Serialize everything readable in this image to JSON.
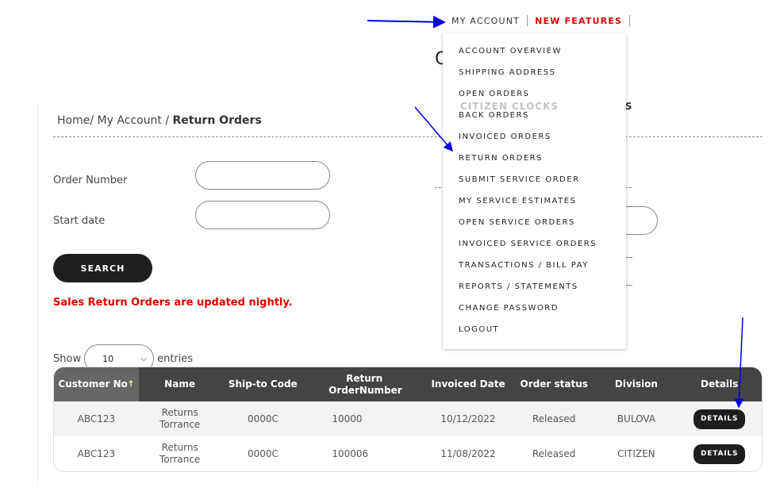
{
  "nav": {
    "my_account": "MY ACCOUNT",
    "new_features": "NEW FEATURES"
  },
  "background": {
    "heading_partial": "CA",
    "tab_citizen_clocks": "CITIZEN CLOCKS",
    "tab_parts": "PARTS"
  },
  "breadcrumb": {
    "home": "Home",
    "sep": "/",
    "my_account": "My Account",
    "current": "Return Orders"
  },
  "form": {
    "order_number_label": "Order Number",
    "order_number_value": "",
    "start_date_label": "Start date",
    "start_date_value": "",
    "search_label": "SEARCH"
  },
  "note": "Sales Return Orders are updated nightly.",
  "entries": {
    "show": "Show",
    "value": "10",
    "entries": "entries"
  },
  "table": {
    "headers": [
      "Customer No",
      "Name",
      "Ship-to Code",
      "Return OrderNumber",
      "Invoiced Date",
      "Order status",
      "Division",
      "Details"
    ],
    "sort_indicator": "↑",
    "rows": [
      {
        "customer": "ABC123",
        "name": "Returns Torrance",
        "ship": "0000C",
        "order": "10000",
        "date": "10/12/2022",
        "status": "Released",
        "division": "BULOVA",
        "details": "DETAILS"
      },
      {
        "customer": "ABC123",
        "name": "Returns Torrance",
        "ship": "0000C",
        "order": "100006",
        "date": "11/08/2022",
        "status": "Released",
        "division": "CITIZEN",
        "details": "DETAILS"
      }
    ]
  },
  "menu": [
    "ACCOUNT OVERVIEW",
    "SHIPPING ADDRESS",
    "OPEN ORDERS",
    "BACK ORDERS",
    "INVOICED ORDERS",
    "RETURN ORDERS",
    "SUBMIT SERVICE ORDER",
    "MY SERVICE ESTIMATES",
    "OPEN SERVICE ORDERS",
    "INVOICED SERVICE ORDERS",
    "TRANSACTIONS / BILL PAY",
    "REPORTS / STATEMENTS",
    "CHANGE PASSWORD",
    "LOGOUT"
  ],
  "colors": {
    "accent_red": "#e00000",
    "dark": "#1e1e1e",
    "header": "#444444",
    "annotation_arrow": "#0000ee"
  }
}
